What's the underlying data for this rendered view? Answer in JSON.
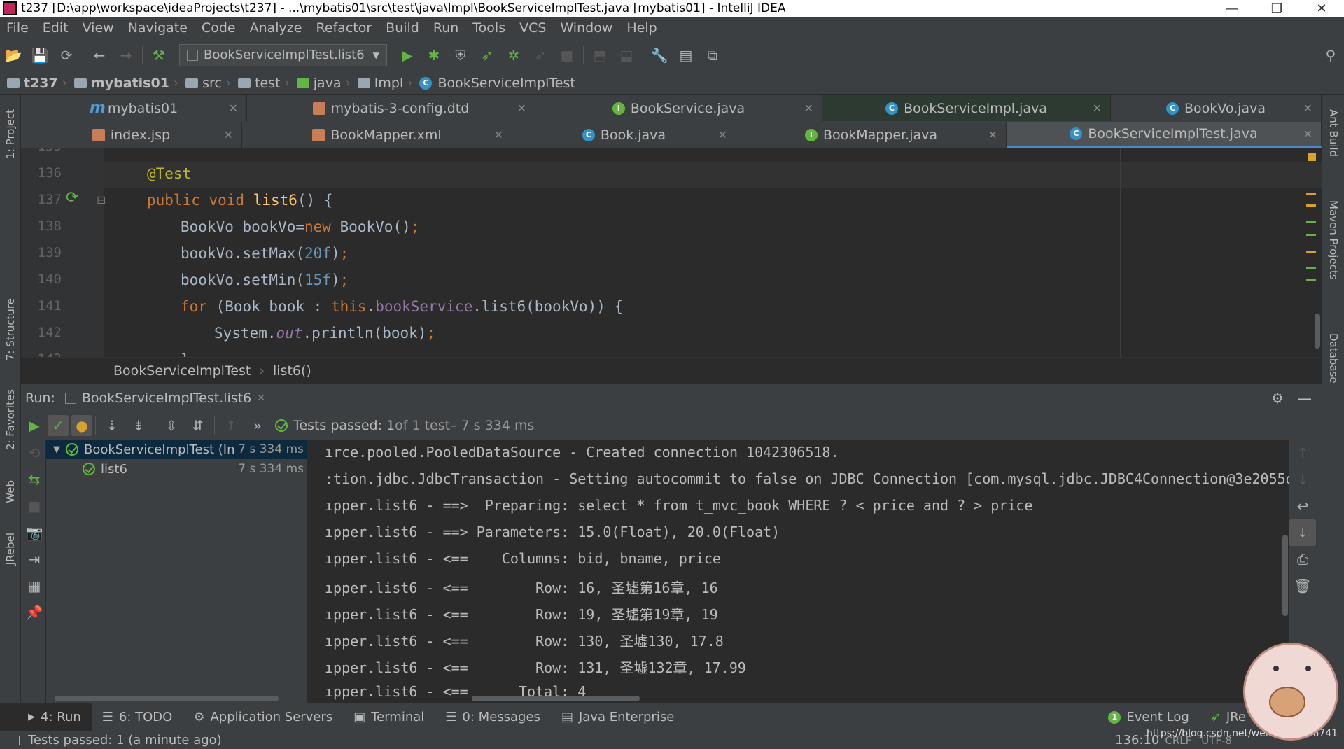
{
  "window": {
    "title": "t237 [D:\\app\\workspace\\ideaProjects\\t237] - ...\\mybatis01\\src\\test\\java\\Impl\\BookServiceImplTest.java [mybatis01] - IntelliJ IDEA",
    "minimize": "—",
    "maximize": "❐",
    "close": "✕"
  },
  "menu": [
    "File",
    "Edit",
    "View",
    "Navigate",
    "Code",
    "Analyze",
    "Refactor",
    "Build",
    "Run",
    "Tools",
    "VCS",
    "Window",
    "Help"
  ],
  "toolbar": {
    "run_config": "BookServiceImplTest.list6"
  },
  "breadcrumbs": [
    "t237",
    "mybatis01",
    "src",
    "test",
    "java",
    "Impl",
    "BookServiceImplTest"
  ],
  "tabs": {
    "row1": [
      {
        "label": "mybatis01",
        "icon": "maven-icon"
      },
      {
        "label": "mybatis-3-config.dtd",
        "icon": "dtd-file-icon"
      },
      {
        "label": "BookService.java",
        "icon": "interface-icon"
      },
      {
        "label": "BookServiceImpl.java",
        "icon": "class-icon"
      },
      {
        "label": "BookVo.java",
        "icon": "class-icon"
      }
    ],
    "row2": [
      {
        "label": "index.jsp",
        "icon": "jsp-file-icon"
      },
      {
        "label": "BookMapper.xml",
        "icon": "xml-file-icon"
      },
      {
        "label": "Book.java",
        "icon": "class-icon"
      },
      {
        "label": "BookMapper.java",
        "icon": "interface-icon"
      },
      {
        "label": "BookServiceImplTest.java",
        "icon": "class-icon",
        "active": true
      }
    ]
  },
  "editor": {
    "line_numbers": [
      "135",
      "136",
      "137",
      "138",
      "139",
      "140",
      "141",
      "142",
      "143"
    ],
    "lines": {
      "l136": "@Test",
      "l137_kw": "public void ",
      "l137_name": "list6",
      "l137_rest": "() {",
      "l138_a": "BookVo bookVo=",
      "l138_kw": "new ",
      "l138_b": "BookVo()",
      "l138_semi": ";",
      "l139_a": "bookVo.setMax(",
      "l139_num": "20f",
      "l139_b": ")",
      "l139_semi": ";",
      "l140_a": "bookVo.setMin(",
      "l140_num": "15f",
      "l140_b": ")",
      "l140_semi": ";",
      "l141_kw": "for ",
      "l141_a": "(Book book : ",
      "l141_this": "this",
      "l141_dot": ".",
      "l141_field": "bookService",
      "l141_b": ".list6(bookVo)) {",
      "l142_a": "System.",
      "l142_out": "out",
      "l142_b": ".println(book)",
      "l142_semi": ";",
      "l143": "}"
    },
    "crumb_class": "BookServiceImplTest",
    "crumb_method": "list6()"
  },
  "run": {
    "label": "Run:",
    "tab": "BookServiceImplTest.list6",
    "status_prefix": "Tests passed: ",
    "status_count": "1",
    "status_suffix": " of 1 test",
    "status_time": " – 7 s 334 ms",
    "tree": [
      {
        "name": "BookServiceImplTest (In",
        "time": "7 s 334 ms"
      },
      {
        "name": "list6",
        "time": "7 s 334 ms"
      }
    ],
    "console": [
      "ırce.pooled.PooledDataSource - Created connection 1042306518.",
      ":tion.jdbc.JdbcTransaction - Setting autocommit to false on JDBC Connection [com.mysql.jdbc.JDBC4Connection@3e2055d6",
      "ıpper.list6 - ==>  Preparing: select * from t_mvc_book WHERE ? < price and ? > price",
      "ıpper.list6 - ==> Parameters: 15.0(Float), 20.0(Float)",
      "ıpper.list6 - <==    Columns: bid, bname, price",
      "ıpper.list6 - <==        Row: 16, 圣墟第16章, 16",
      "ıpper.list6 - <==        Row: 19, 圣墟第19章, 19",
      "ıpper.list6 - <==        Row: 130, 圣墟130, 17.8",
      "ıpper.list6 - <==        Row: 131, 圣墟132章, 17.99",
      "ıpper.list6 - <==      Total: 4"
    ]
  },
  "bottom_tools": [
    {
      "num": "4",
      "label": ": Run"
    },
    {
      "num": "6",
      "label": ": TODO"
    },
    {
      "num": "",
      "label": "Application Servers"
    },
    {
      "num": "",
      "label": "Terminal"
    },
    {
      "num": "0",
      "label": ": Messages"
    },
    {
      "num": "",
      "label": "Java Enterprise"
    }
  ],
  "bottom_right": {
    "event_log": "Event Log",
    "event_count": "1",
    "jrebel": "JRe"
  },
  "status": {
    "text": "Tests passed: 1 (a minute ago)",
    "position": "136:10",
    "line_sep": "CRLF",
    "encoding": "UTF-8",
    "watermark": "https://blog.csdn.net/weixin_45346741"
  },
  "side_labels": {
    "left": [
      "1: Project",
      "7: Structure",
      "2: Favorites",
      "Web",
      "JRebel"
    ],
    "right": [
      "Ant Build",
      "Maven Projects",
      "Database"
    ]
  }
}
